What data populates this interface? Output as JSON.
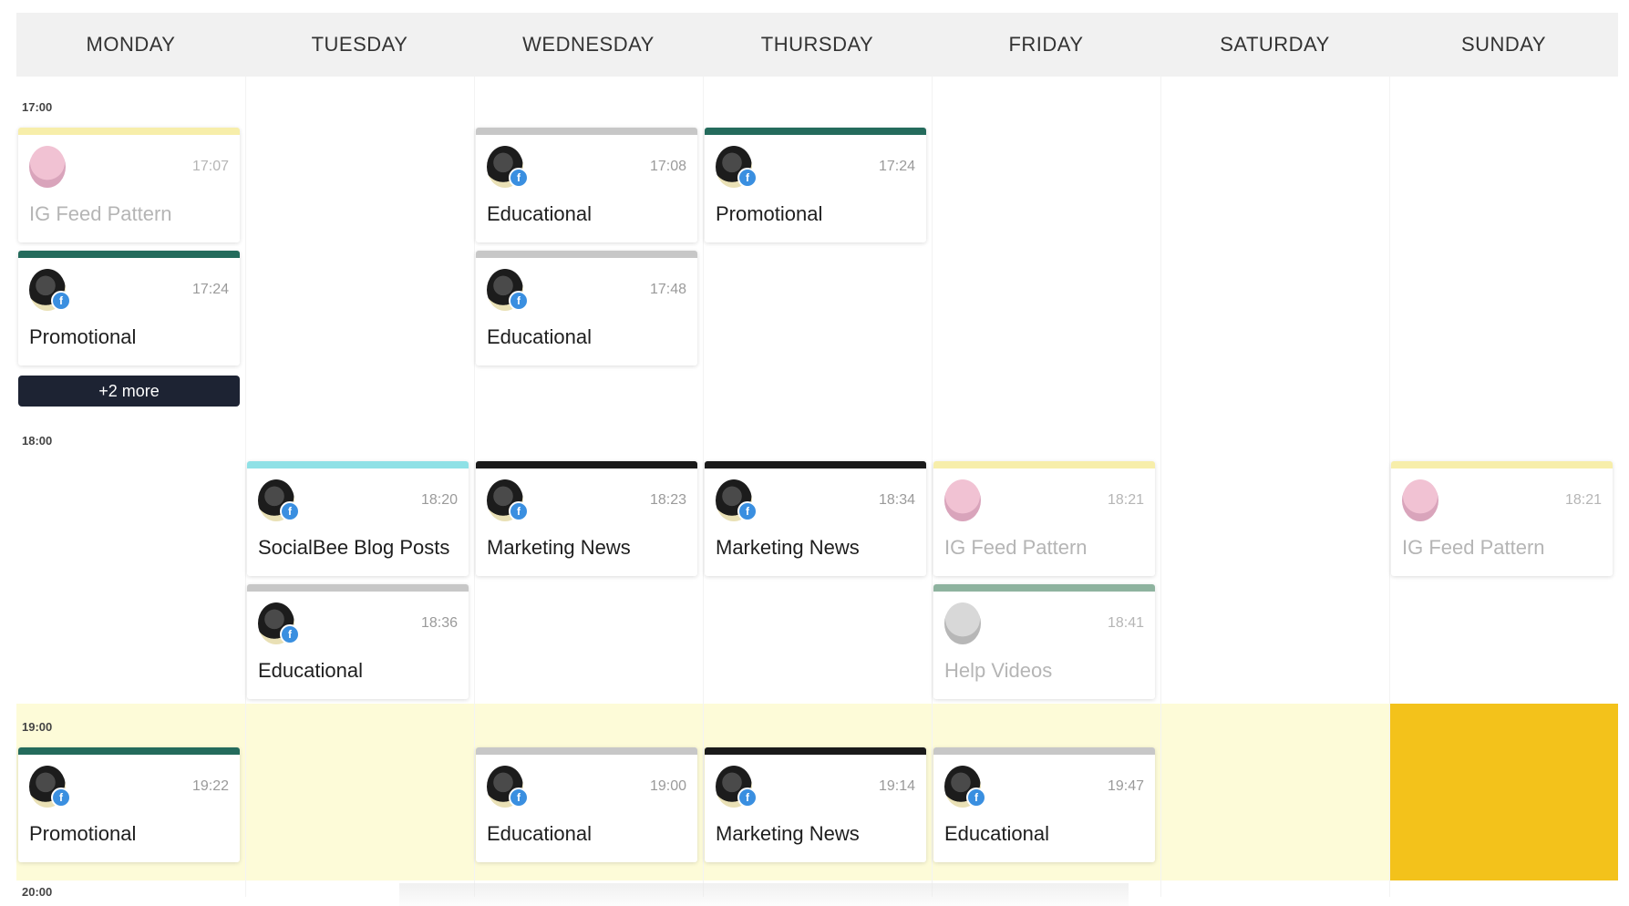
{
  "days": [
    "MONDAY",
    "TUESDAY",
    "WEDNESDAY",
    "THURSDAY",
    "FRIDAY",
    "SATURDAY",
    "SUNDAY"
  ],
  "hours": [
    "17:00",
    "18:00",
    "19:00",
    "20:00"
  ],
  "colors": {
    "yellow": "#f7eeaa",
    "teal_dark": "#246b5c",
    "gray": "#c7c7c7",
    "cyan": "#8fe1e6",
    "black": "#1a1a1a",
    "green_muted": "#8eb39f",
    "now_highlight": "#f3c21b",
    "hour_band": "#fdfbd8"
  },
  "more_button": {
    "label": "+2 more"
  },
  "posts": [
    {
      "day": "MONDAY",
      "time": "17:07",
      "title": "IG Feed Pattern",
      "bar": "yellow",
      "faded": true
    },
    {
      "day": "MONDAY",
      "time": "17:24",
      "title": "Promotional",
      "bar": "teal_dark",
      "faded": false
    },
    {
      "day": "WEDNESDAY",
      "time": "17:08",
      "title": "Educational",
      "bar": "gray",
      "faded": false
    },
    {
      "day": "WEDNESDAY",
      "time": "17:48",
      "title": "Educational",
      "bar": "gray",
      "faded": false
    },
    {
      "day": "THURSDAY",
      "time": "17:24",
      "title": "Promotional",
      "bar": "teal_dark",
      "faded": false
    },
    {
      "day": "TUESDAY",
      "time": "18:20",
      "title": "SocialBee Blog Posts",
      "bar": "cyan",
      "faded": false
    },
    {
      "day": "TUESDAY",
      "time": "18:36",
      "title": "Educational",
      "bar": "gray",
      "faded": false
    },
    {
      "day": "WEDNESDAY",
      "time": "18:23",
      "title": "Marketing News",
      "bar": "black",
      "faded": false
    },
    {
      "day": "THURSDAY",
      "time": "18:34",
      "title": "Marketing News",
      "bar": "black",
      "faded": false
    },
    {
      "day": "FRIDAY",
      "time": "18:21",
      "title": "IG Feed Pattern",
      "bar": "yellow",
      "faded": true
    },
    {
      "day": "FRIDAY",
      "time": "18:41",
      "title": "Help Videos",
      "bar": "green_muted",
      "faded": true
    },
    {
      "day": "SUNDAY",
      "time": "18:21",
      "title": "IG Feed Pattern",
      "bar": "yellow",
      "faded": true
    },
    {
      "day": "MONDAY",
      "time": "19:22",
      "title": "Promotional",
      "bar": "teal_dark",
      "faded": false
    },
    {
      "day": "WEDNESDAY",
      "time": "19:00",
      "title": "Educational",
      "bar": "gray",
      "faded": false
    },
    {
      "day": "THURSDAY",
      "time": "19:14",
      "title": "Marketing News",
      "bar": "black",
      "faded": false
    },
    {
      "day": "FRIDAY",
      "time": "19:47",
      "title": "Educational",
      "bar": "gray",
      "faded": false
    }
  ]
}
